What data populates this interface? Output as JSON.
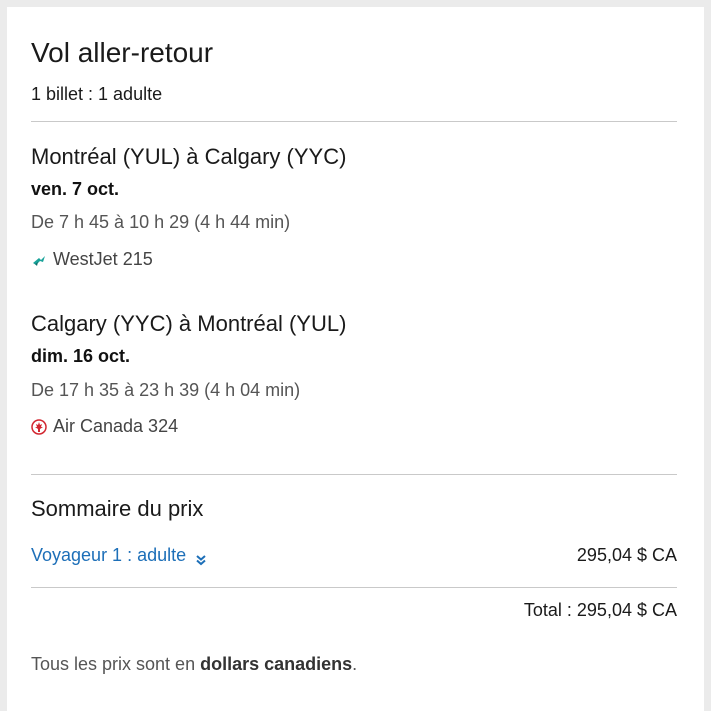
{
  "summary": {
    "title": "Vol aller-retour",
    "subtitle": "1 billet : 1 adulte"
  },
  "legs": [
    {
      "route": "Montréal (YUL) à Calgary (YYC)",
      "date": "ven. 7 oct.",
      "times": "De 7 h 45 à 10 h 29 (4 h 44 min)",
      "airline": "WestJet 215",
      "airline_icon": "westjet-logo-icon",
      "airline_color": "#1aa39a"
    },
    {
      "route": "Calgary (YYC) à Montréal (YUL)",
      "date": "dim. 16 oct.",
      "times": "De 17 h 35 à 23 h 39 (4 h 04 min)",
      "airline": "Air Canada 324",
      "airline_icon": "air-canada-logo-icon",
      "airline_color": "#d22630"
    }
  ],
  "price_summary": {
    "title": "Sommaire du prix",
    "traveler_label": "Voyageur 1 : adulte",
    "traveler_price": "295,04 $ CA",
    "total": "Total : 295,04 $ CA",
    "note_prefix": "Tous les prix sont en ",
    "note_bold": "dollars canadiens",
    "note_suffix": "."
  },
  "colors": {
    "link": "#1d6fb8",
    "divider": "#c9c9c9"
  }
}
